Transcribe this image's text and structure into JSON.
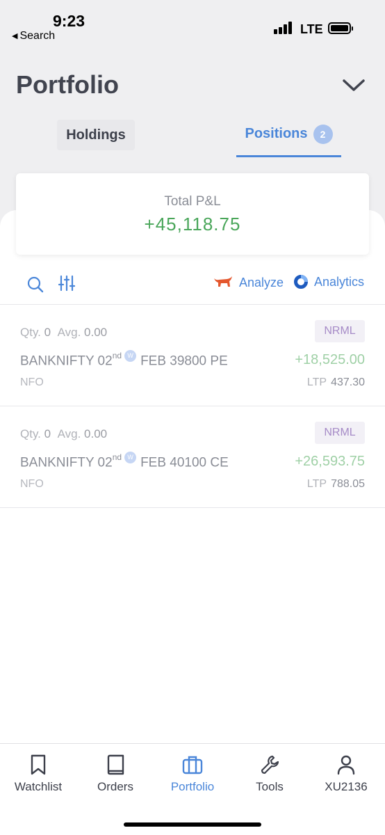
{
  "status": {
    "time": "9:23",
    "back_label": "Search",
    "network": "LTE"
  },
  "header": {
    "title": "Portfolio"
  },
  "tabs": {
    "holdings": "Holdings",
    "positions": "Positions",
    "positions_count": "2"
  },
  "summary": {
    "label": "Total P&L",
    "value": "+45,118.75"
  },
  "toolbar": {
    "analyze": "Analyze",
    "analytics": "Analytics"
  },
  "positions": [
    {
      "qty_label": "Qty.",
      "qty": "0",
      "avg_label": "Avg.",
      "avg": "0.00",
      "product": "NRML",
      "symbol": "BANKNIFTY 02",
      "suffix": "nd",
      "weekly": "W",
      "expiry": "FEB 39800 PE",
      "pnl": "+18,525.00",
      "exchange": "NFO",
      "ltp_label": "LTP",
      "ltp": "437.30"
    },
    {
      "qty_label": "Qty.",
      "qty": "0",
      "avg_label": "Avg.",
      "avg": "0.00",
      "product": "NRML",
      "symbol": "BANKNIFTY 02",
      "suffix": "nd",
      "weekly": "W",
      "expiry": "FEB 40100 CE",
      "pnl": "+26,593.75",
      "exchange": "NFO",
      "ltp_label": "LTP",
      "ltp": "788.05"
    }
  ],
  "nav": {
    "watchlist": "Watchlist",
    "orders": "Orders",
    "portfolio": "Portfolio",
    "tools": "Tools",
    "account": "XU2136"
  },
  "colors": {
    "accent": "#4a86d9",
    "profit": "#4aa65a",
    "product_tag": "#a68bc7"
  }
}
